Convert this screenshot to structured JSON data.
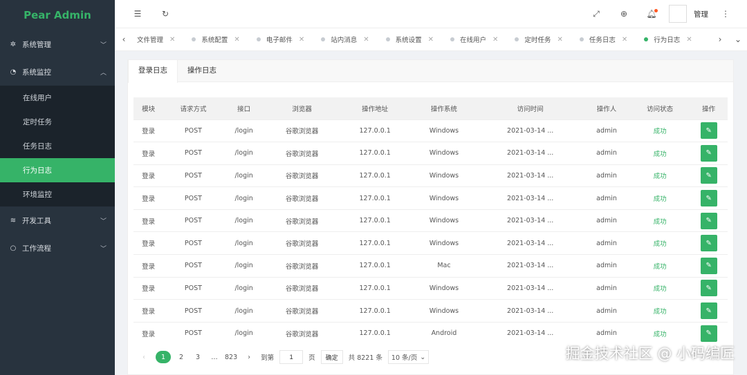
{
  "brand": {
    "name": "Pear Admin",
    "color": "#36b368"
  },
  "sidebar": {
    "menus": [
      {
        "icon": "gear-icon",
        "glyph": "✲",
        "label": "系统管理",
        "expanded": false
      },
      {
        "icon": "dashboard-icon",
        "glyph": "◔",
        "label": "系统监控",
        "expanded": true,
        "children": [
          {
            "label": "在线用户"
          },
          {
            "label": "定时任务"
          },
          {
            "label": "任务日志"
          },
          {
            "label": "行为日志",
            "active": true
          },
          {
            "label": "环境监控"
          }
        ]
      },
      {
        "icon": "tools-icon",
        "glyph": "≋",
        "label": "开发工具",
        "expanded": false
      },
      {
        "icon": "workflow-icon",
        "glyph": "○",
        "label": "工作流程",
        "expanded": false
      }
    ]
  },
  "header": {
    "user_name": "管理"
  },
  "tabs": [
    {
      "label": "文件管理",
      "active": false
    },
    {
      "label": "系统配置",
      "active": false
    },
    {
      "label": "电子邮件",
      "active": false
    },
    {
      "label": "站内消息",
      "active": false
    },
    {
      "label": "系统设置",
      "active": false
    },
    {
      "label": "在线用户",
      "active": false
    },
    {
      "label": "定时任务",
      "active": false
    },
    {
      "label": "任务日志",
      "active": false
    },
    {
      "label": "行为日志",
      "active": true
    }
  ],
  "subtabs": [
    {
      "label": "登录日志",
      "active": true
    },
    {
      "label": "操作日志",
      "active": false
    }
  ],
  "table": {
    "columns": [
      "模块",
      "请求方式",
      "接口",
      "浏览器",
      "操作地址",
      "操作系统",
      "访问时间",
      "操作人",
      "访问状态",
      "操作"
    ],
    "rows": [
      [
        "登录",
        "POST",
        "/login",
        "谷歌浏览器",
        "127.0.0.1",
        "Windows",
        "2021-03-14 ...",
        "admin",
        "成功"
      ],
      [
        "登录",
        "POST",
        "/login",
        "谷歌浏览器",
        "127.0.0.1",
        "Windows",
        "2021-03-14 ...",
        "admin",
        "成功"
      ],
      [
        "登录",
        "POST",
        "/login",
        "谷歌浏览器",
        "127.0.0.1",
        "Windows",
        "2021-03-14 ...",
        "admin",
        "成功"
      ],
      [
        "登录",
        "POST",
        "/login",
        "谷歌浏览器",
        "127.0.0.1",
        "Windows",
        "2021-03-14 ...",
        "admin",
        "成功"
      ],
      [
        "登录",
        "POST",
        "/login",
        "谷歌浏览器",
        "127.0.0.1",
        "Windows",
        "2021-03-14 ...",
        "admin",
        "成功"
      ],
      [
        "登录",
        "POST",
        "/login",
        "谷歌浏览器",
        "127.0.0.1",
        "Windows",
        "2021-03-14 ...",
        "admin",
        "成功"
      ],
      [
        "登录",
        "POST",
        "/login",
        "谷歌浏览器",
        "127.0.0.1",
        "Mac",
        "2021-03-14 ...",
        "admin",
        "成功"
      ],
      [
        "登录",
        "POST",
        "/login",
        "谷歌浏览器",
        "127.0.0.1",
        "Windows",
        "2021-03-14 ...",
        "admin",
        "成功"
      ],
      [
        "登录",
        "POST",
        "/login",
        "谷歌浏览器",
        "127.0.0.1",
        "Windows",
        "2021-03-14 ...",
        "admin",
        "成功"
      ],
      [
        "登录",
        "POST",
        "/login",
        "谷歌浏览器",
        "127.0.0.1",
        "Android",
        "2021-03-14 ...",
        "admin",
        "成功"
      ]
    ]
  },
  "pagination": {
    "pages": [
      "1",
      "2",
      "3",
      "…",
      "823"
    ],
    "current": "1",
    "jump_prefix": "到第",
    "jump_value": "1",
    "jump_suffix": "页",
    "confirm_label": "确定",
    "total_text": "共 8221 条",
    "page_size": "10 条/页"
  },
  "watermark": "掘金技术社区 @ 小码编匠"
}
